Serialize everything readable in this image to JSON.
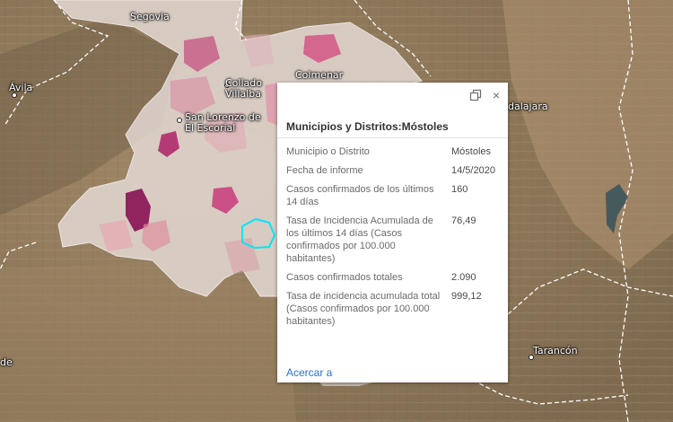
{
  "map": {
    "places": [
      {
        "id": "segovia",
        "name": "Segovia"
      },
      {
        "id": "avila",
        "name": "Ávila"
      },
      {
        "id": "collado",
        "name": "Collado\nVillalba"
      },
      {
        "id": "colmenar",
        "name": "Colmenar"
      },
      {
        "id": "sanlorenzo",
        "name": "San Lorenzo de\nEl Escorial"
      },
      {
        "id": "guadalajara",
        "name": "dalajara"
      },
      {
        "id": "tarancon",
        "name": "Tarancón"
      },
      {
        "id": "edge_de",
        "name": "de"
      }
    ],
    "colors": {
      "terrain": "#8f7a5c",
      "region_fill": "#e6dcd8",
      "highlight": "#00e5ff",
      "incidence_high": "#8b1a5a",
      "incidence_mid": "#c93a7a",
      "incidence_low": "#e89aa8"
    }
  },
  "popup": {
    "title": "Municipios y Distritos:Móstoles",
    "dock_icon": "dock-icon",
    "close_icon": "close-icon",
    "close_glyph": "×",
    "rows": [
      {
        "label": "Municipio o Distrito",
        "value": "Móstoles"
      },
      {
        "label": "Fecha de informe",
        "value": "14/5/2020"
      },
      {
        "label": "Casos confirmados de los últimos 14 días",
        "value": "160"
      },
      {
        "label": "Tasa de Incidencia Acumulada de los últimos 14 días (Casos confirmados por 100.000 habitantes)",
        "value": "76,49"
      },
      {
        "label": "Casos confirmados totales",
        "value": "2.090"
      },
      {
        "label": "Tasa de incidencia acumulada total (Casos confirmados por 100.000 habitantes)",
        "value": "999,12"
      }
    ],
    "zoom_label": "Acercar a"
  }
}
